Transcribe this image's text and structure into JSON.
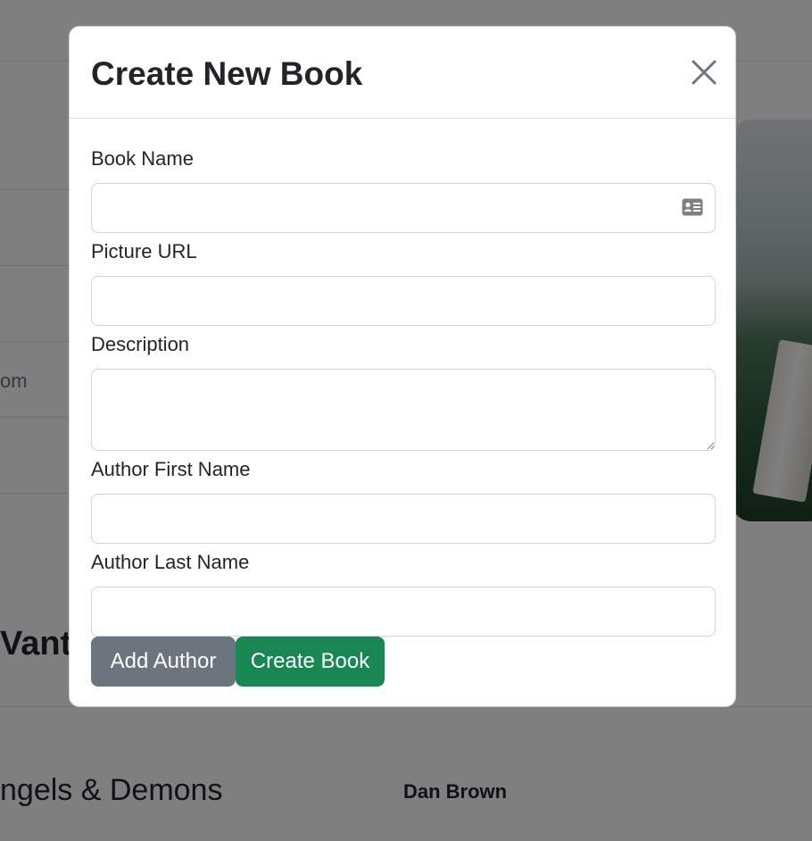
{
  "background": {
    "email_fragment": "om",
    "heading_fragment": "Vant",
    "book_title_fragment": "ngels & Demons",
    "book_author": "Dan Brown"
  },
  "modal": {
    "title": "Create New Book",
    "fields": {
      "book_name": {
        "label": "Book Name",
        "value": ""
      },
      "picture_url": {
        "label": "Picture URL",
        "value": ""
      },
      "description": {
        "label": "Description",
        "value": ""
      },
      "author_first_name": {
        "label": "Author First Name",
        "value": ""
      },
      "author_last_name": {
        "label": "Author Last Name",
        "value": ""
      }
    },
    "buttons": {
      "add_author": "Add Author",
      "create_book": "Create Book"
    }
  },
  "colors": {
    "secondary": "#6c757d",
    "success": "#198754",
    "overlay": "rgba(0,0,0,0.5)"
  },
  "icons": {
    "close": "close-icon",
    "input_autofill": "contact-card-icon"
  }
}
